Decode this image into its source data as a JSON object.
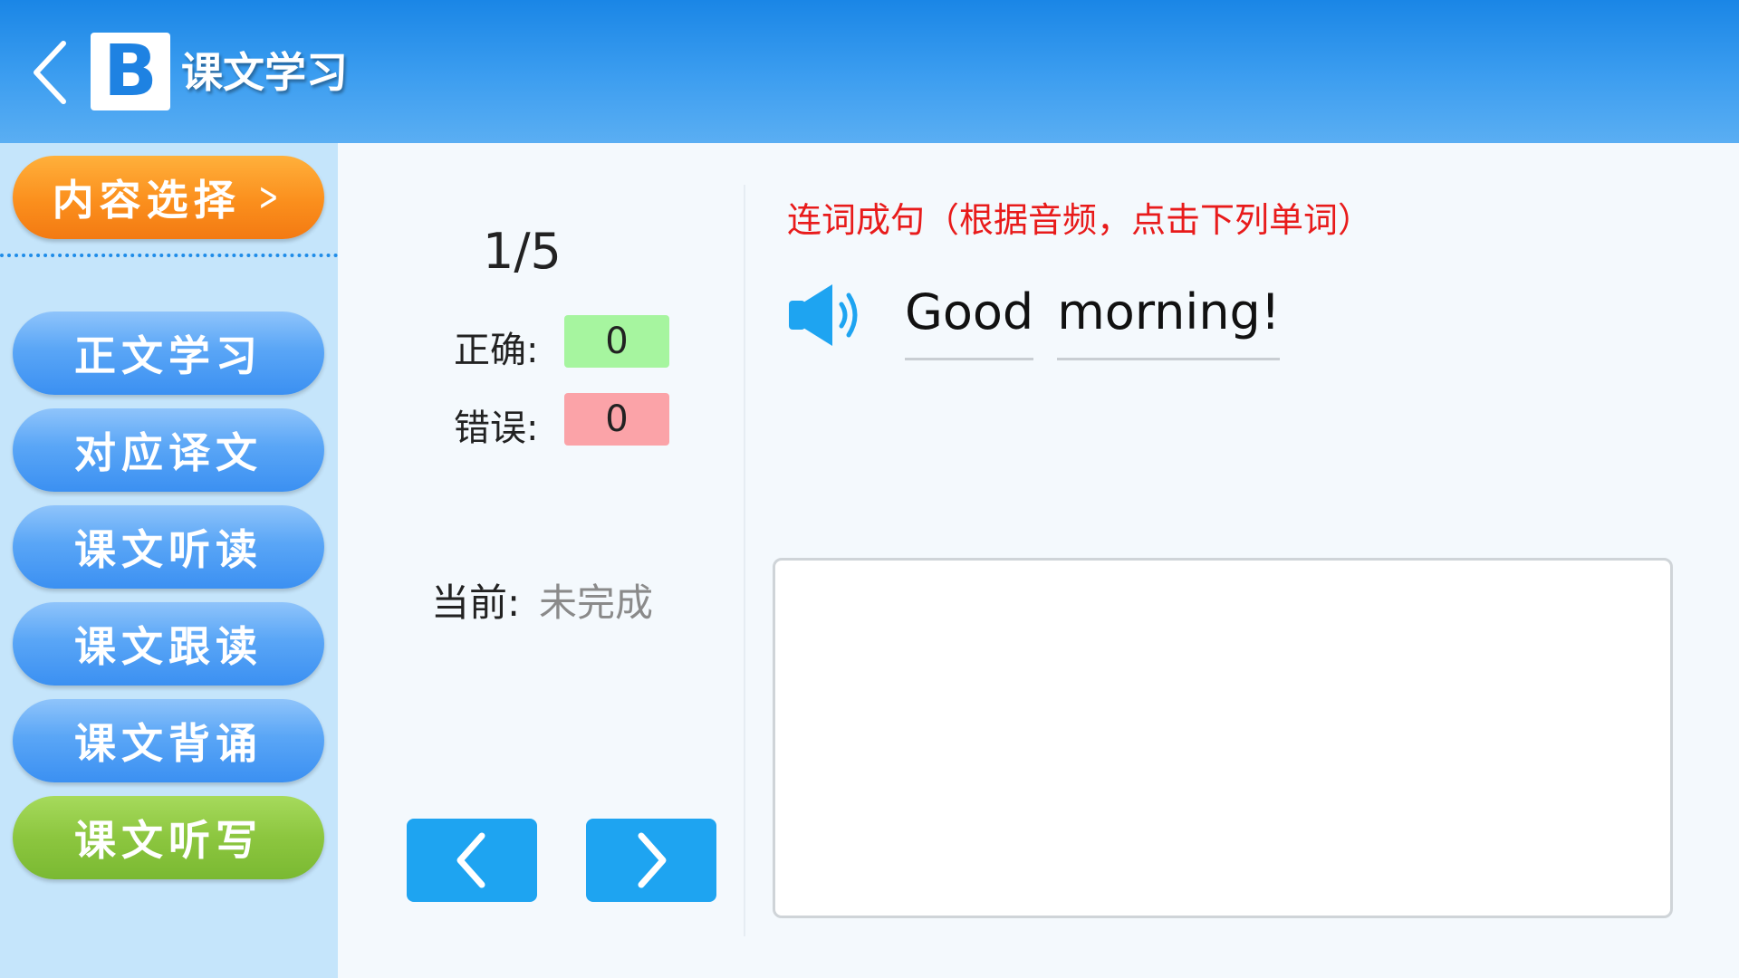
{
  "header": {
    "logo_letter": "B",
    "title": "课文学习"
  },
  "sidebar": {
    "content_select_label": "内容选择",
    "items": [
      {
        "label": "正文学习",
        "active": false
      },
      {
        "label": "对应译文",
        "active": false
      },
      {
        "label": "课文听读",
        "active": false
      },
      {
        "label": "课文跟读",
        "active": false
      },
      {
        "label": "课文背诵",
        "active": false
      },
      {
        "label": "课文听写",
        "active": true
      }
    ]
  },
  "stats": {
    "progress": "1/5",
    "correct_label": "正确:",
    "correct_value": "0",
    "wrong_label": "错误:",
    "wrong_value": "0",
    "current_label": "当前:",
    "current_value": "未完成"
  },
  "exercise": {
    "instruction": "连词成句（根据音频，点击下列单词）",
    "words": [
      "Good",
      "morning!"
    ],
    "answer_text": ""
  },
  "colors": {
    "header_blue": "#1a86e6",
    "accent_orange": "#fb8f1d",
    "nav_blue": "#5aa6f6",
    "active_green": "#8cc63f",
    "arrow_blue": "#1ea4f1",
    "instruction_red": "#e81b1b",
    "correct_green": "#a6f59f",
    "wrong_red": "#fba3a8"
  },
  "icons": {
    "back": "chevron-left-icon",
    "speaker": "speaker-icon",
    "prev": "chevron-left-icon",
    "next": "chevron-right-icon"
  }
}
